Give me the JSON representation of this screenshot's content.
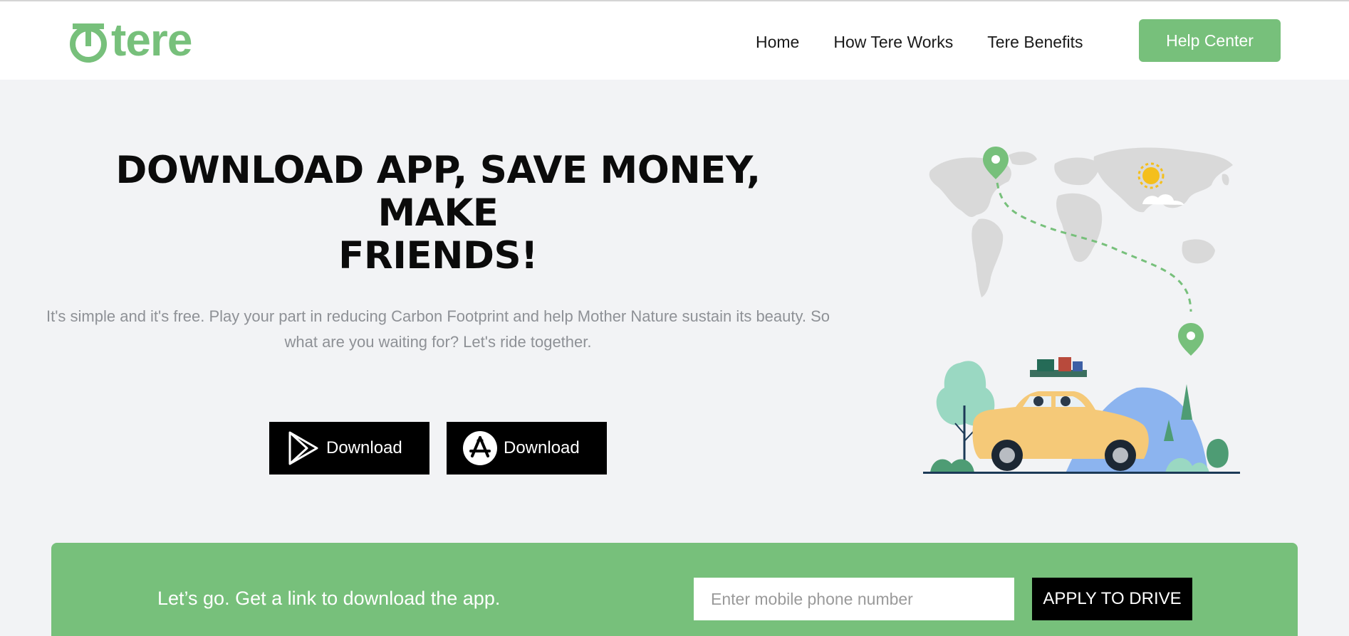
{
  "brand": {
    "name": "tere",
    "color": "#77c07b"
  },
  "nav": {
    "links": [
      {
        "label": "Home"
      },
      {
        "label": "How Tere Works"
      },
      {
        "label": "Tere Benefits"
      }
    ],
    "help_label": "Help Center"
  },
  "hero": {
    "title_line1": "DOWNLOAD APP, SAVE MONEY, MAKE",
    "title_line2": "FRIENDS!",
    "subtitle": "It's simple and it's free. Play your part in reducing Carbon Footprint and help Mother Nature sustain its beauty. So what are you waiting for? Let's ride together.",
    "download_buttons": [
      {
        "icon": "google-play-icon",
        "label": "Download"
      },
      {
        "icon": "app-store-icon",
        "label": "Download"
      }
    ]
  },
  "illustration": {
    "icon": "world-map-car-illustration"
  },
  "cta": {
    "text": "Let’s go. Get a link to download the app.",
    "phone_placeholder": "Enter mobile phone number",
    "apply_label": "APPLY TO DRIVE"
  }
}
